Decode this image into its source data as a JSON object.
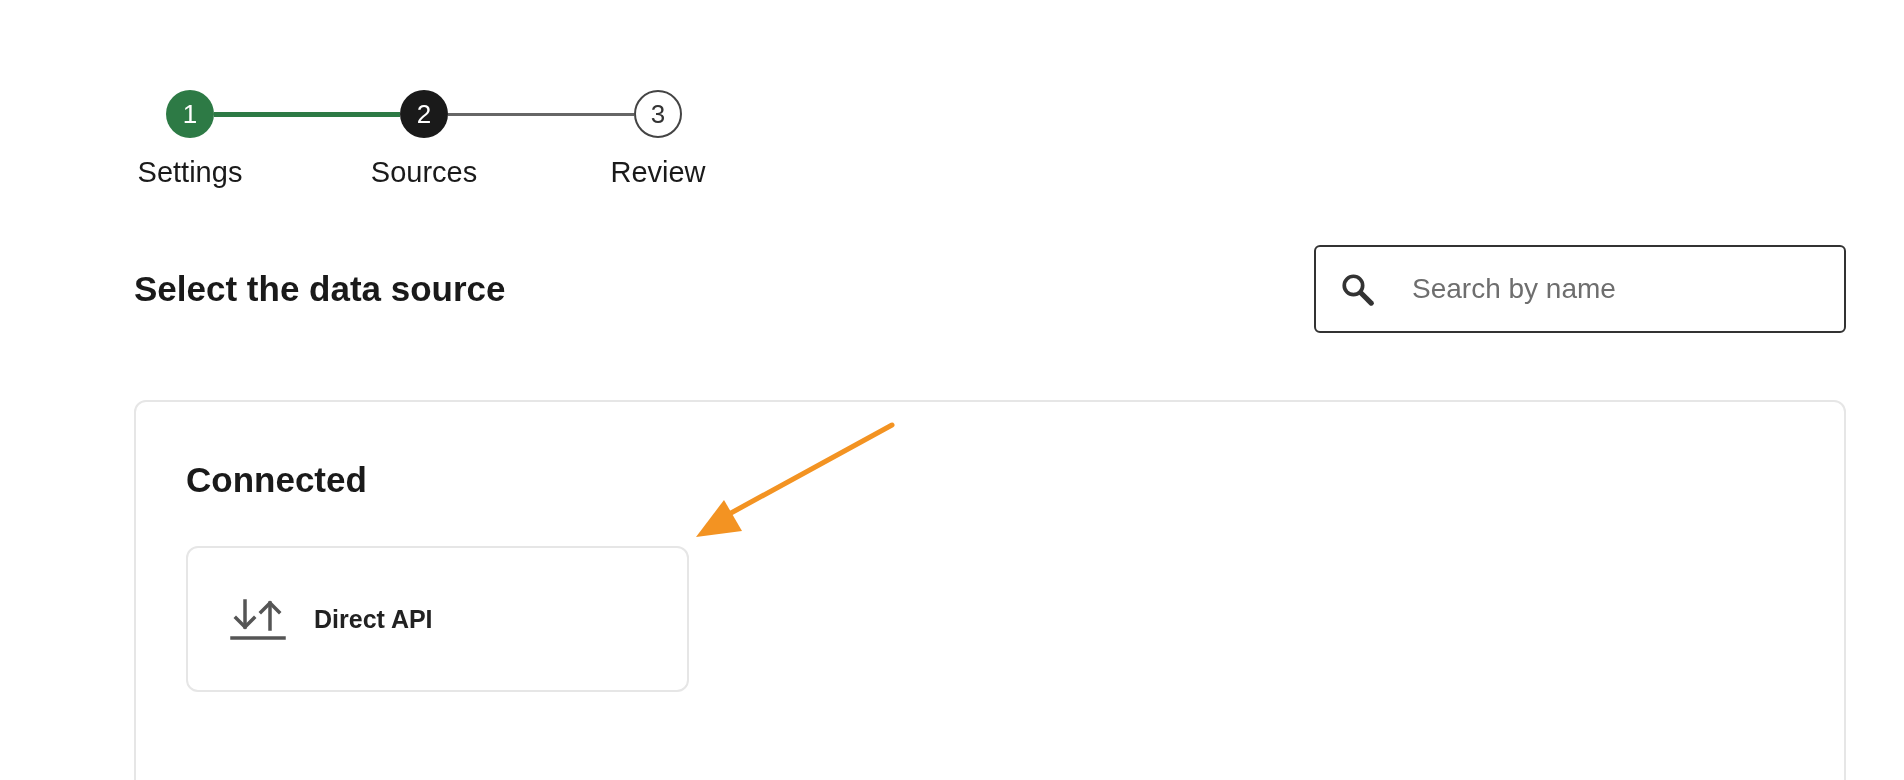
{
  "stepper": {
    "steps": [
      {
        "number": "1",
        "label": "Settings",
        "kind": "complete"
      },
      {
        "number": "2",
        "label": "Sources",
        "kind": "current"
      },
      {
        "number": "3",
        "label": "Review",
        "kind": "upcoming"
      }
    ]
  },
  "header": {
    "title": "Select the data source",
    "search": {
      "placeholder": "Search by name"
    }
  },
  "section": {
    "title": "Connected",
    "sources": [
      {
        "name": "Direct API"
      }
    ]
  },
  "annotation": {
    "kind": "arrow"
  }
}
